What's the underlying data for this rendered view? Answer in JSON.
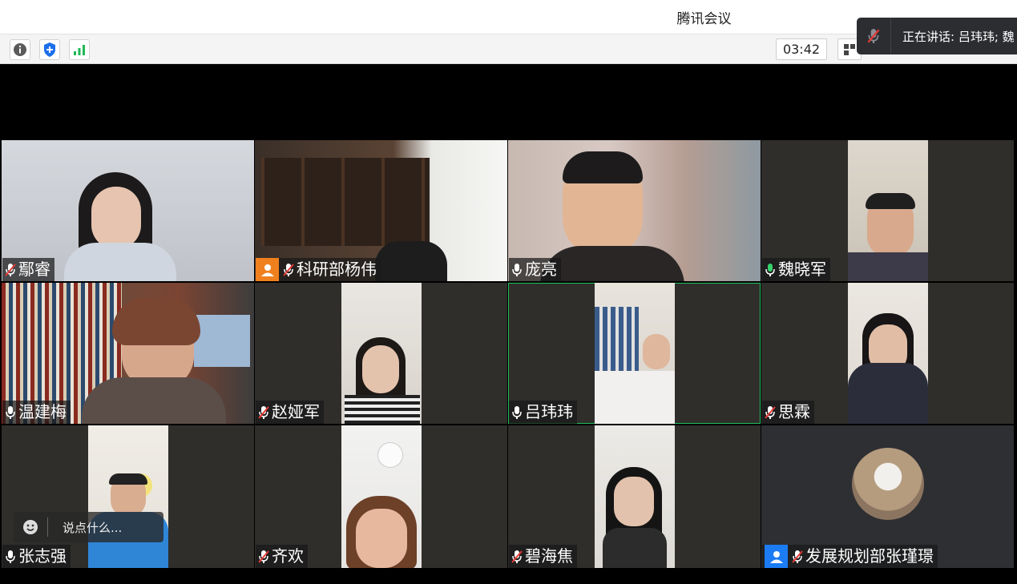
{
  "app": {
    "title": "腾讯会议"
  },
  "toolbar": {
    "timer": "03:42"
  },
  "speaker_toast": {
    "text": "正在讲话: 吕玮玮; 魏"
  },
  "chat": {
    "placeholder": "说点什么..."
  },
  "participants": [
    {
      "name": "鄢睿",
      "mic": "muted",
      "video": "on"
    },
    {
      "name": "科研部杨伟",
      "mic": "muted",
      "video": "on",
      "avatar_badge": "orange"
    },
    {
      "name": "庞亮",
      "mic": "on",
      "video": "on"
    },
    {
      "name": "魏晓军",
      "mic": "speaking",
      "video": "on"
    },
    {
      "name": "温建梅",
      "mic": "on",
      "video": "on"
    },
    {
      "name": "赵娅军",
      "mic": "muted",
      "video": "on"
    },
    {
      "name": "吕玮玮",
      "mic": "on",
      "video": "on",
      "active": true
    },
    {
      "name": "思霖",
      "mic": "muted",
      "video": "on"
    },
    {
      "name": "张志强",
      "mic": "on",
      "video": "on"
    },
    {
      "name": "齐欢",
      "mic": "muted",
      "video": "on"
    },
    {
      "name": "碧海焦",
      "mic": "muted",
      "video": "on"
    },
    {
      "name": "发展规划部张瑾璟",
      "mic": "muted",
      "video": "off",
      "avatar_badge": "blue"
    }
  ],
  "colors": {
    "active_border": "#20c05c",
    "speaking_mic": "#35d16a",
    "orange_badge": "#f0801e",
    "blue_badge": "#1c7cf4"
  }
}
